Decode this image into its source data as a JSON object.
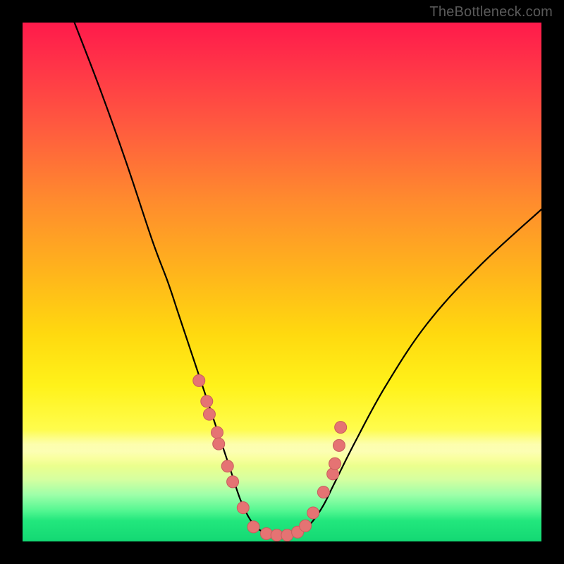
{
  "watermark": "TheBottleneck.com",
  "colors": {
    "curve_stroke": "#000000",
    "marker_fill": "#e57373",
    "marker_stroke": "#c85d5d",
    "frame_bg": "#000000"
  },
  "chart_data": {
    "type": "line",
    "title": "",
    "xlabel": "",
    "ylabel": "",
    "xlim": [
      0,
      100
    ],
    "ylim": [
      0,
      100
    ],
    "grid": false,
    "legend": false,
    "notes": "V-shaped curve descending from top-left to a flat minimum near x≈44–54, then rising toward upper-right. No axis ticks or labels are shown. Pink circular markers cluster on both flanks of the valley and along its floor.",
    "series": [
      {
        "name": "curve",
        "x": [
          10,
          15,
          20,
          25,
          28,
          30,
          32,
          34,
          36,
          38,
          40,
          42,
          44,
          46,
          48,
          50,
          52,
          54,
          56,
          58,
          60,
          64,
          70,
          78,
          88,
          100
        ],
        "y": [
          100,
          87,
          73,
          58,
          50,
          44,
          38,
          32,
          26,
          20,
          14,
          8,
          4,
          2,
          1.2,
          1,
          1.2,
          2,
          4,
          7,
          11,
          19,
          30,
          42,
          53,
          64
        ]
      }
    ],
    "markers": {
      "name": "highlighted-points",
      "x": [
        34.0,
        35.5,
        36.0,
        37.5,
        37.8,
        39.5,
        40.5,
        42.5,
        44.5,
        47.0,
        49.0,
        51.0,
        53.0,
        54.5,
        56.0,
        58.0,
        59.8,
        60.2,
        61.0,
        61.3
      ],
      "y": [
        31.0,
        27.0,
        24.5,
        21.0,
        18.8,
        14.5,
        11.5,
        6.5,
        2.8,
        1.5,
        1.2,
        1.2,
        1.8,
        3.0,
        5.5,
        9.5,
        13.0,
        15.0,
        18.5,
        22.0
      ]
    }
  }
}
